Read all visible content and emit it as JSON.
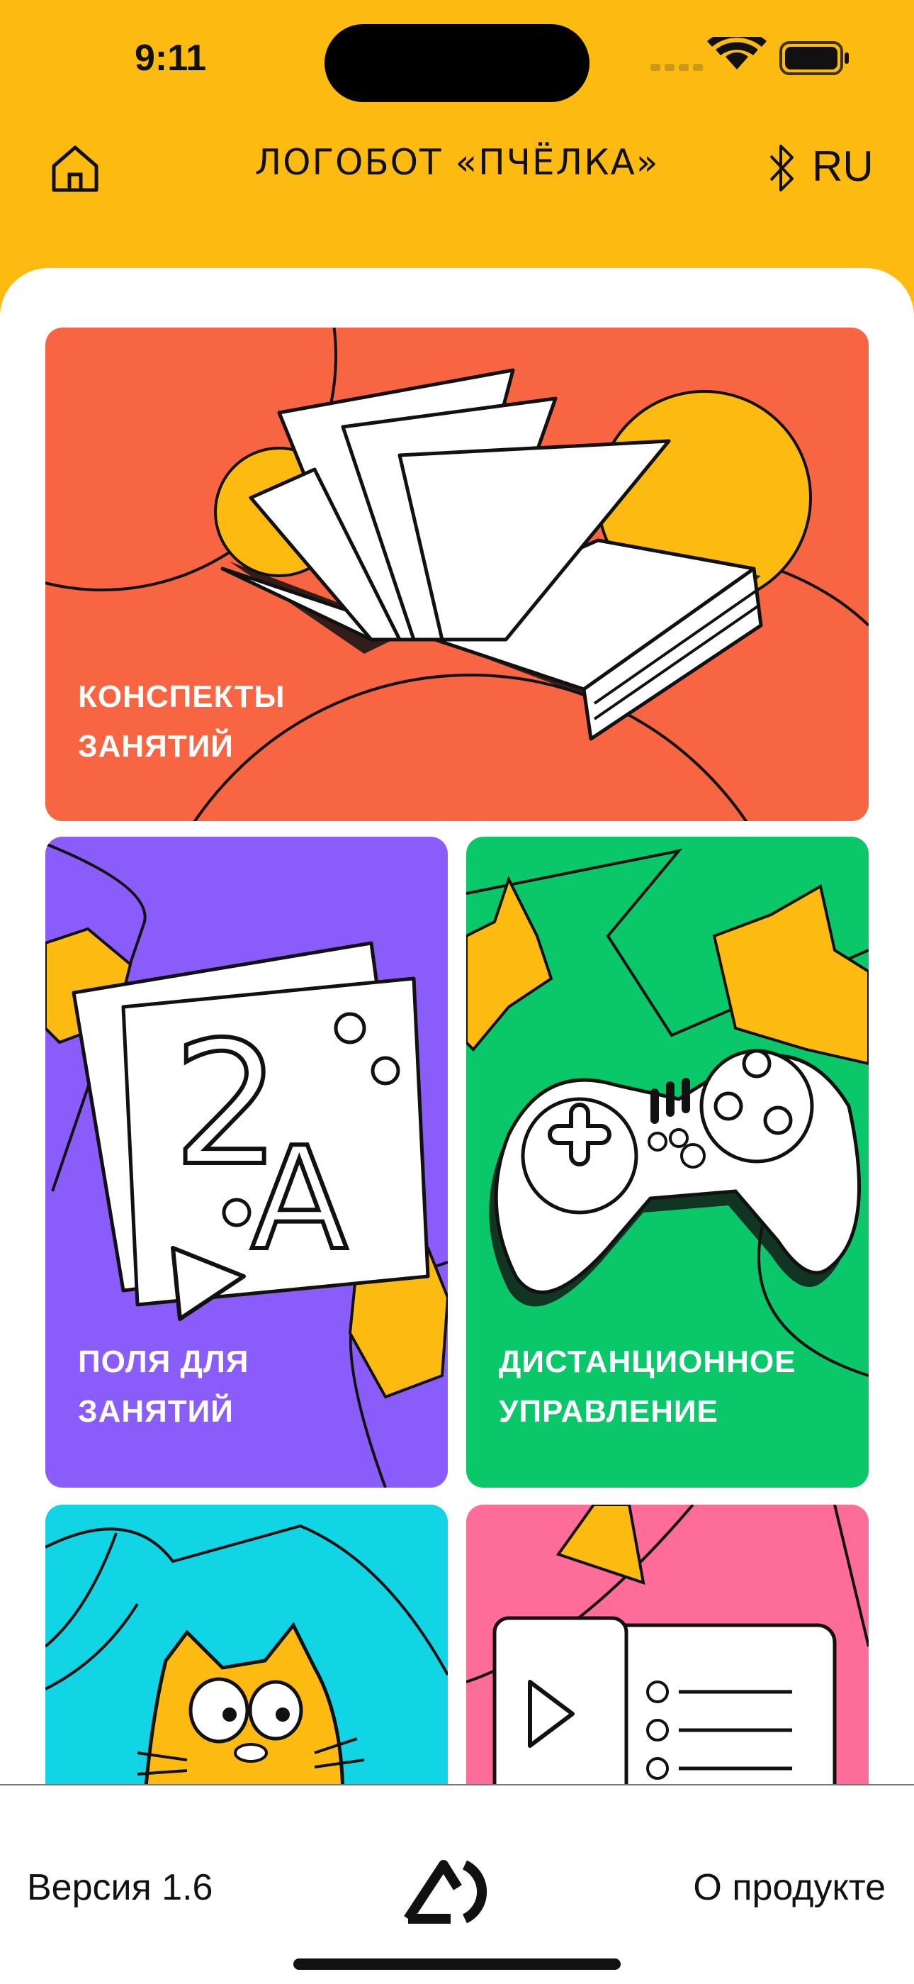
{
  "status_bar": {
    "time": "9:11"
  },
  "header": {
    "title": "ЛОГОБОТ «ПЧЁЛКА»",
    "language": "RU"
  },
  "cards": [
    {
      "line1": "КОНСПЕКТЫ",
      "line2": "ЗАНЯТИЙ",
      "color": "#F86543"
    },
    {
      "line1": "ПОЛЯ ДЛЯ",
      "line2": "ЗАНЯТИЙ",
      "color": "#8A5CF9"
    },
    {
      "line1": "ДИСТАНЦИОННОЕ",
      "line2": "УПРАВЛЕНИЕ",
      "color": "#0AC76A"
    },
    {
      "line1": "",
      "line2": "",
      "color": "#11D5E5"
    },
    {
      "line1": "",
      "line2": "",
      "color": "#FE6C9A"
    }
  ],
  "footer": {
    "version": "Версия 1.6",
    "about": "О продукте"
  },
  "icons": [
    "home-icon",
    "bluetooth-icon",
    "book-illustration",
    "cards-illustration",
    "gamepad-illustration",
    "cat-illustration",
    "video-list-illustration",
    "brand-logo-icon",
    "wifi-icon",
    "battery-icon",
    "cellular-icon"
  ],
  "colors": {
    "accent": "#FDBB11"
  }
}
